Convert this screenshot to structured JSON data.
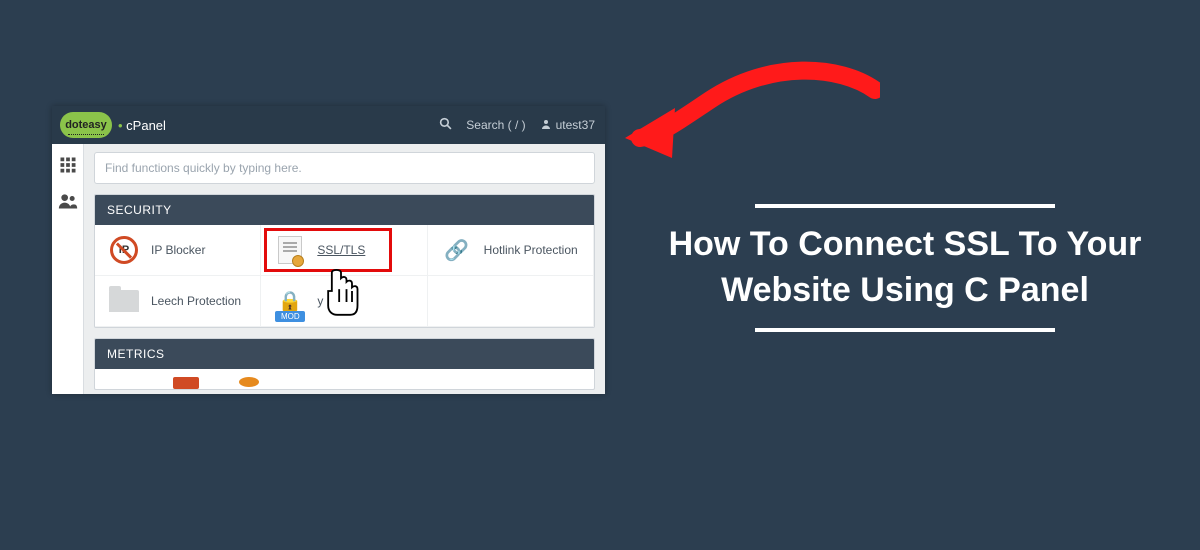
{
  "title": "How To Connect SSL To Your Website Using C Panel",
  "topbar": {
    "logo_text": "doteasy",
    "product": "cPanel",
    "search_placeholder": "Search ( / )",
    "username": "utest37"
  },
  "find_placeholder": "Find functions quickly by typing here.",
  "sections": {
    "security": {
      "header": "SECURITY",
      "items": {
        "ip_blocker": "IP Blocker",
        "ssl_tls": "SSL/TLS",
        "hotlink": "Hotlink Protection",
        "leech": "Leech Protection",
        "modsec_short": "y",
        "mod_tag": "MOD"
      }
    },
    "metrics": {
      "header": "METRICS"
    }
  },
  "colors": {
    "canvas": "#2c3e50",
    "accent_green": "#8bc34a",
    "highlight_red": "#e30b0b",
    "arrow_red": "#ff1a1a",
    "header_dark": "#293a4a"
  }
}
